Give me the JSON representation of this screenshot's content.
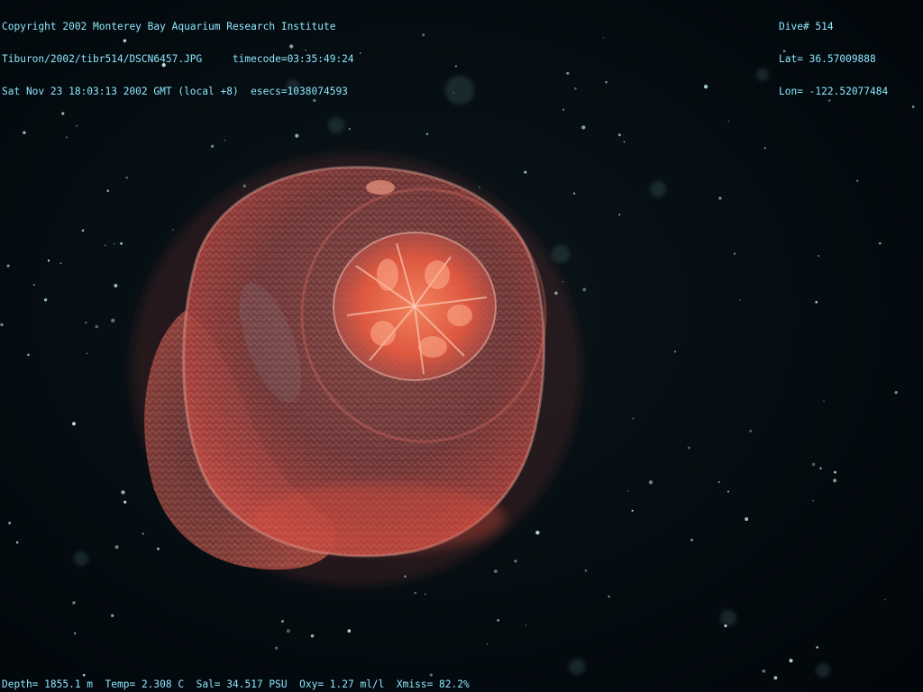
{
  "overlay": {
    "top_left": {
      "line1": "Copyright 2002 Monterey Bay Aquarium Research Institute",
      "line2": "Tiburon/2002/tibr514/DSCN6457.JPG     timecode=03:35:49:24",
      "line3": "Sat Nov 23 18:03:13 2002 GMT (local +8)  esecs=1038074593"
    },
    "top_right": {
      "dive": "Dive# 514",
      "lat": "Lat= 36.57009888",
      "lon": "Lon= -122.52077484"
    },
    "bottom": {
      "depth": "Depth= 1855.1 m",
      "temp": "Temp= 2.308 C",
      "sal": "Sal= 34.517 PSU",
      "oxy": "Oxy= 1.27 ml/l",
      "xmiss": "Xmiss= 82.2%"
    },
    "text_color": "#8fe8ff"
  },
  "scene": {
    "background_color": "#02080b",
    "subject": "jellyfish",
    "bell_color": "#b0524c",
    "stomach_color": "#ff6a4a"
  }
}
